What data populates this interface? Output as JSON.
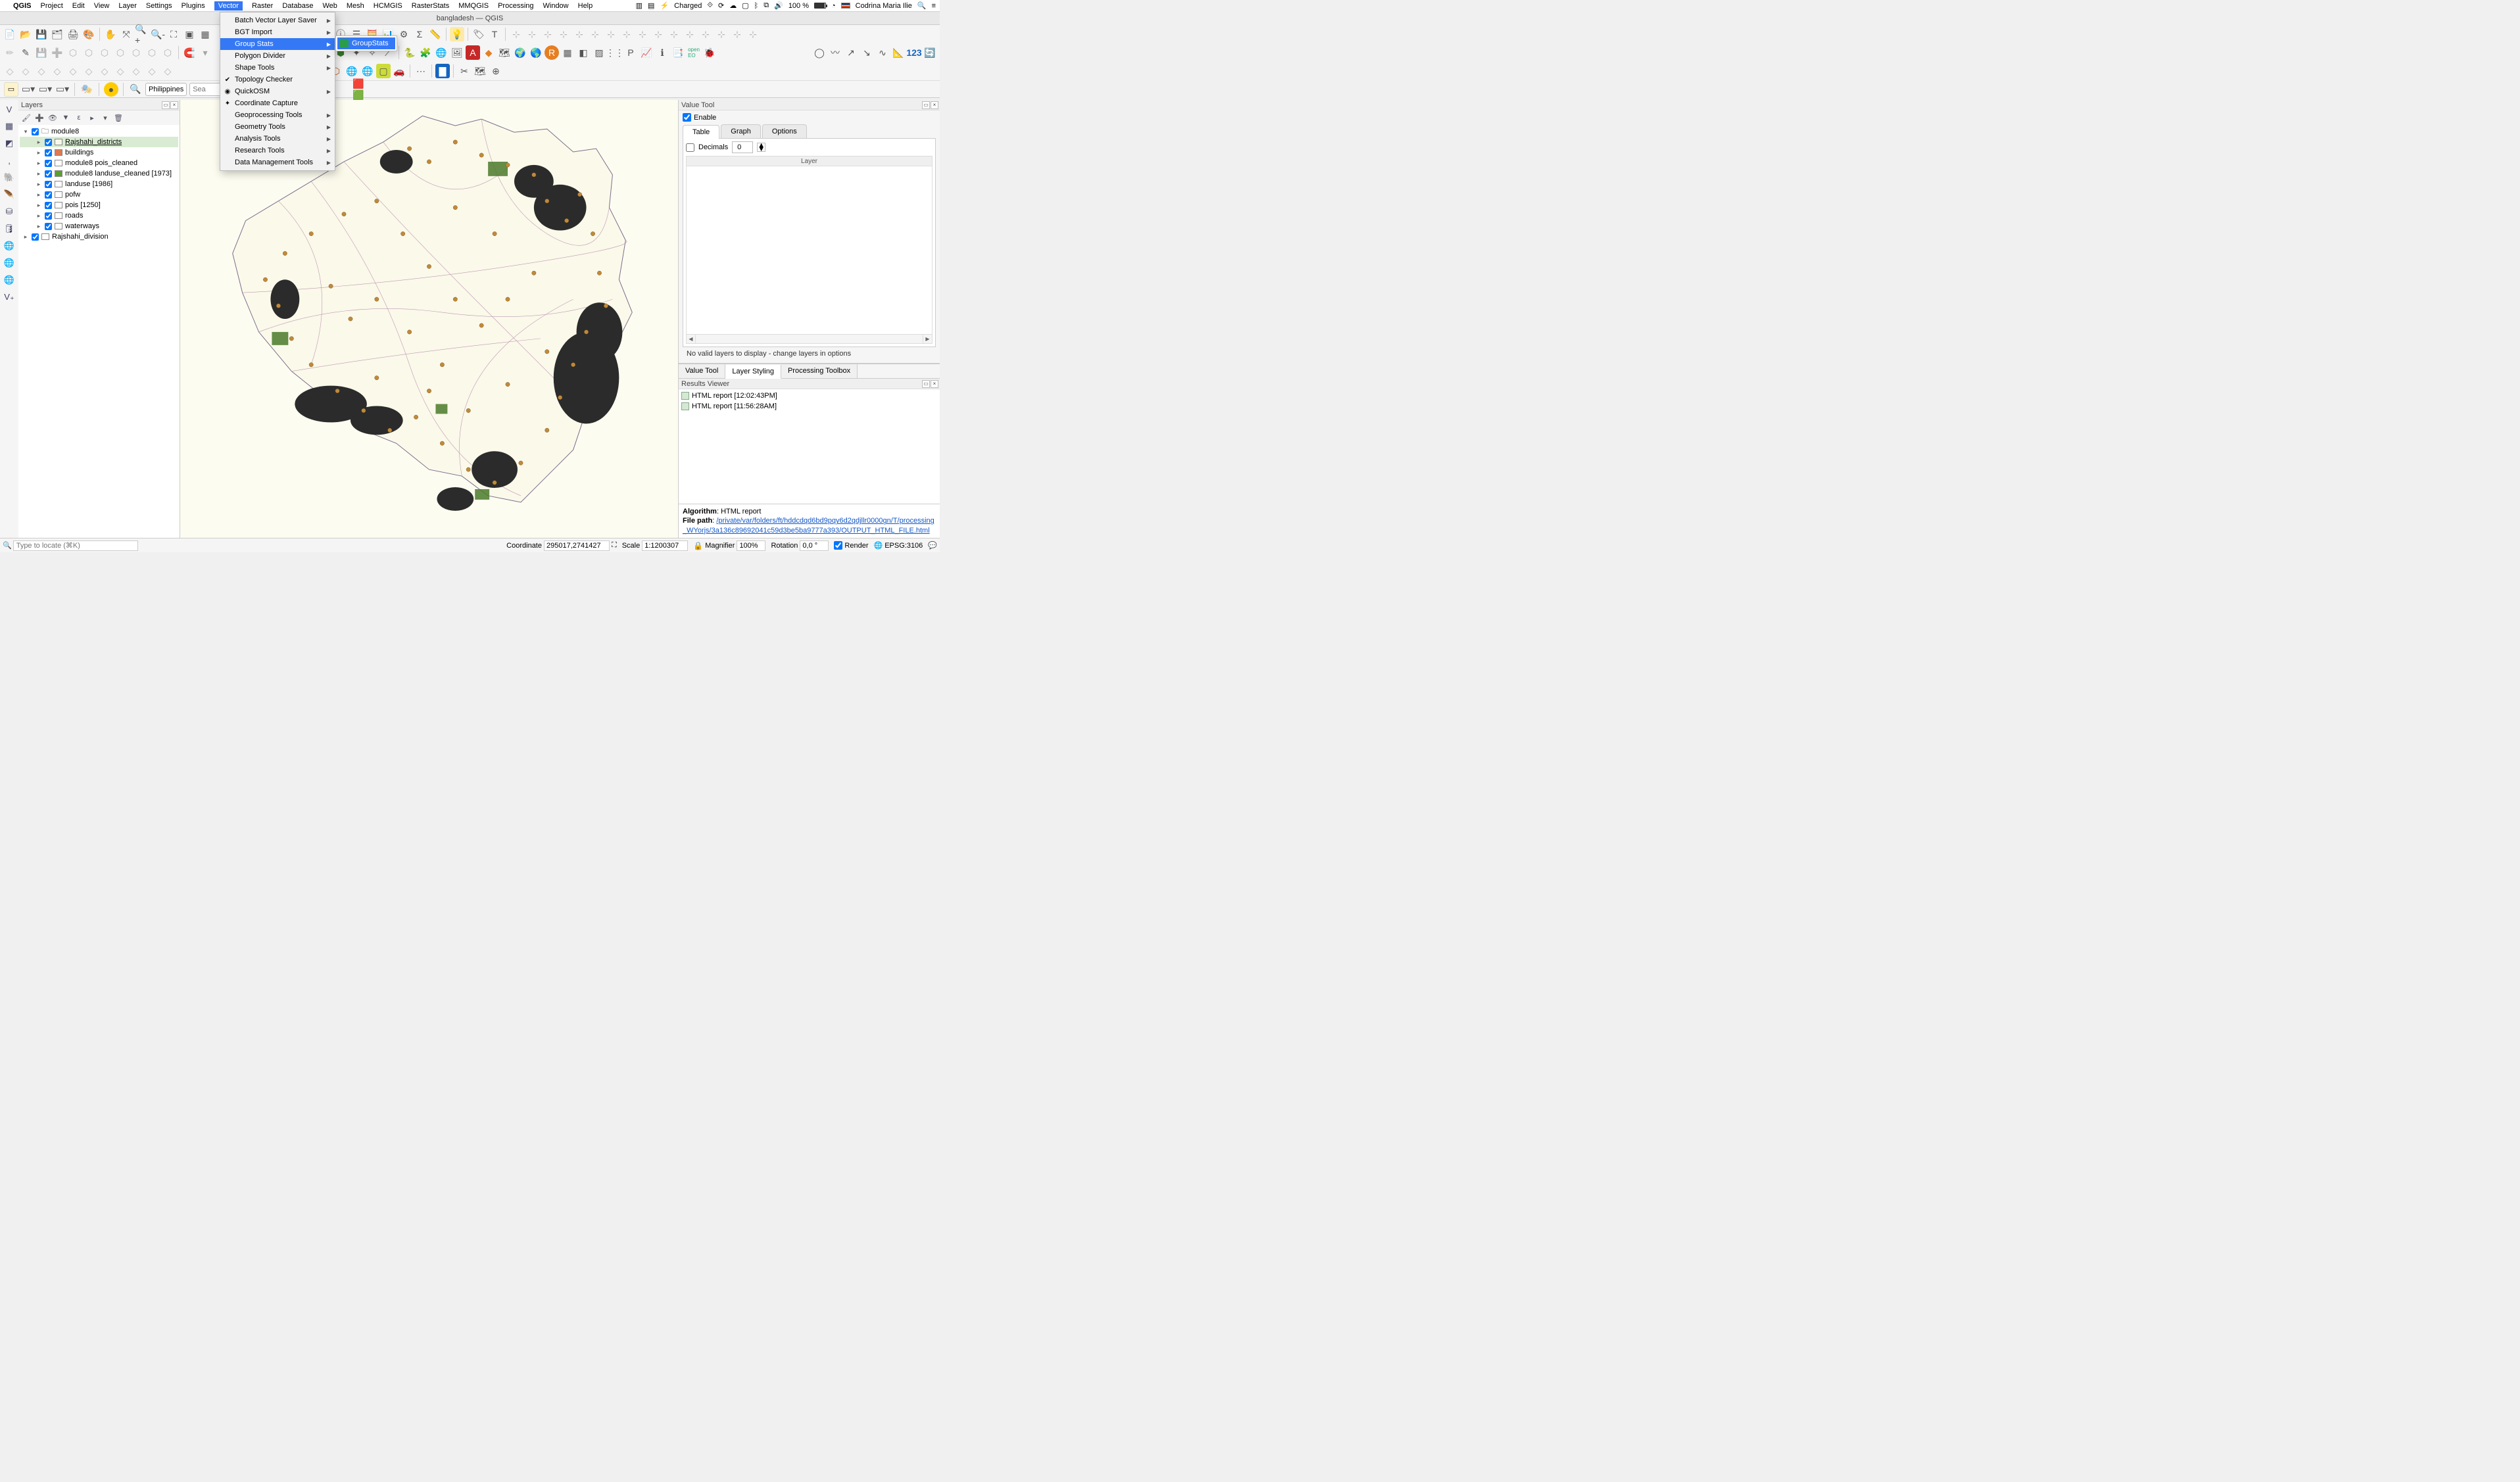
{
  "mac_menubar": {
    "app": "QGIS",
    "items": [
      "Project",
      "Edit",
      "View",
      "Layer",
      "Settings",
      "Plugins",
      "Vector",
      "Raster",
      "Database",
      "Web",
      "Mesh",
      "HCMGIS",
      "RasterStats",
      "MMQGIS",
      "Processing",
      "Window",
      "Help"
    ],
    "active": "Vector",
    "status": {
      "charged": "Charged",
      "percent": "100 %",
      "user": "Codrina Maria Ilie"
    }
  },
  "window_title": "bangladesh — QGIS",
  "vector_menu": [
    {
      "label": "Batch Vector Layer Saver",
      "sub": true
    },
    {
      "label": "BGT Import",
      "sub": true
    },
    {
      "label": "Group Stats",
      "sub": true,
      "sel": true
    },
    {
      "label": "Polygon Divider",
      "sub": true
    },
    {
      "label": "Shape Tools",
      "sub": true
    },
    {
      "label": "Topology Checker",
      "icon": "✔"
    },
    {
      "label": "QuickOSM",
      "sub": true,
      "icon": "◉"
    },
    {
      "label": "Coordinate Capture",
      "icon": "✦"
    },
    {
      "label": "Geoprocessing Tools",
      "sub": true
    },
    {
      "label": "Geometry Tools",
      "sub": true
    },
    {
      "label": "Analysis Tools",
      "sub": true
    },
    {
      "label": "Research Tools",
      "sub": true
    },
    {
      "label": "Data Management Tools",
      "sub": true
    }
  ],
  "submenu_item": "GroupStats",
  "filter_bar": {
    "country": "Philippines",
    "search_placeholder": "Sea"
  },
  "layers_panel_title": "Layers",
  "layers": {
    "group": "module8",
    "items": [
      {
        "name": "Rajshahi_districts",
        "color": "#f7f7eb",
        "sel": true
      },
      {
        "name": "buildings",
        "color": "#e07850"
      },
      {
        "name": "module8 pois_cleaned",
        "color": ""
      },
      {
        "name": "module8 landuse_cleaned [1973]",
        "color": "#5aa02c"
      },
      {
        "name": "landuse [1986]",
        "color": ""
      },
      {
        "name": "pofw",
        "color": ""
      },
      {
        "name": "pois [1250]",
        "color": ""
      },
      {
        "name": "roads",
        "color": ""
      },
      {
        "name": "waterways",
        "color": ""
      }
    ],
    "lone": "Rajshahi_division"
  },
  "value_tool": {
    "title": "Value Tool",
    "enable": "Enable",
    "tabs": [
      "Table",
      "Graph",
      "Options"
    ],
    "decimals_label": "Decimals",
    "decimals_value": "0",
    "layer_header": "Layer",
    "novalid": "No valid layers to display - change layers in options"
  },
  "bottom_tabs": [
    "Value Tool",
    "Layer Styling",
    "Processing Toolbox"
  ],
  "results": {
    "title": "Results Viewer",
    "rows": [
      "HTML report [12:02:43PM]",
      "HTML report [11:56:28AM]"
    ],
    "algorithm_label": "Algorithm",
    "algorithm_value": "HTML report",
    "filepath_label": "File path",
    "filepath_value": "/private/var/folders/ft/hddcdqd6bd9pqy6d2qdjllr0000gn/T/processing_WYorjs/3a136c89692041c59d3be5ba9777a393/OUTPUT_HTML_FILE.html"
  },
  "statusbar": {
    "locator_placeholder": "Type to locate (⌘K)",
    "coord_label": "Coordinate",
    "coord_value": "295017,2741427",
    "scale_label": "Scale",
    "scale_value": "1:1200307",
    "magnifier_label": "Magnifier",
    "magnifier_value": "100%",
    "rotation_label": "Rotation",
    "rotation_value": "0,0 °",
    "render_label": "Render",
    "epsg": "EPSG:3106"
  }
}
